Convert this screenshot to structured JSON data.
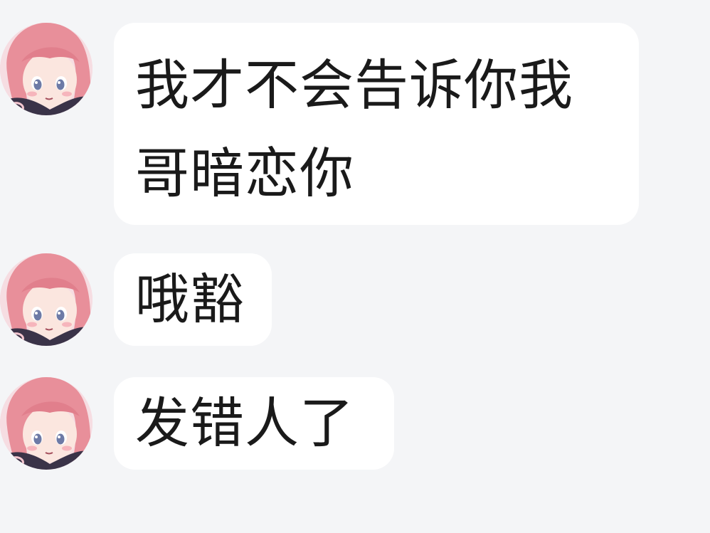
{
  "messages": [
    {
      "sender_avatar": "anime-girl-pink-hair-avatar",
      "text": "我才不会告诉你我哥暗恋你"
    },
    {
      "sender_avatar": "anime-girl-pink-hair-avatar",
      "text": "哦豁"
    },
    {
      "sender_avatar": "anime-girl-pink-hair-avatar",
      "text": "发错人了"
    }
  ],
  "colors": {
    "background": "#f4f5f7",
    "bubble": "#ffffff",
    "text": "#1a1a1a"
  }
}
